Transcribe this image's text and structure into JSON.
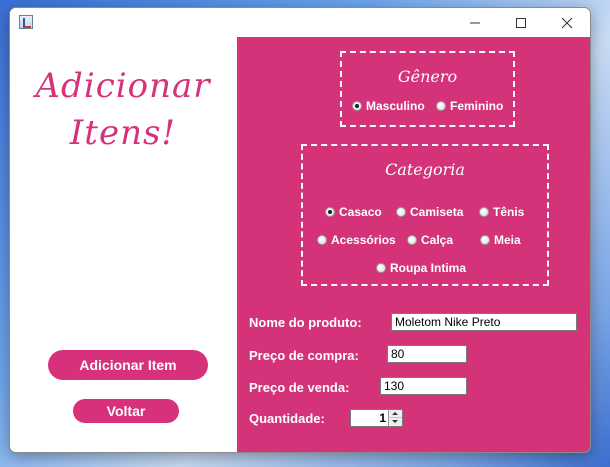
{
  "left": {
    "title_line1": "Adicionar",
    "title_line2": "Itens!",
    "add_button": "Adicionar Item",
    "back_button": "Voltar"
  },
  "genero": {
    "title": "Gênero",
    "options": [
      {
        "label": "Masculino",
        "checked": true
      },
      {
        "label": "Feminino",
        "checked": false
      }
    ]
  },
  "categoria": {
    "title": "Categoria",
    "options": [
      {
        "label": "Casaco",
        "checked": true
      },
      {
        "label": "Camiseta",
        "checked": false
      },
      {
        "label": "Tênis",
        "checked": false
      },
      {
        "label": "Acessórios",
        "checked": false
      },
      {
        "label": "Calça",
        "checked": false
      },
      {
        "label": "Meia",
        "checked": false
      },
      {
        "label": "Roupa Intima",
        "checked": false
      }
    ]
  },
  "form": {
    "nome_label": "Nome do produto:",
    "nome_value": "Moletom Nike Preto",
    "compra_label": "Preço de compra:",
    "compra_value": "80",
    "venda_label": "Preço de venda:",
    "venda_value": "130",
    "quantidade_label": "Quantidade:",
    "quantidade_value": "1"
  },
  "colors": {
    "accent": "#d4337a",
    "button": "#d6317a"
  }
}
